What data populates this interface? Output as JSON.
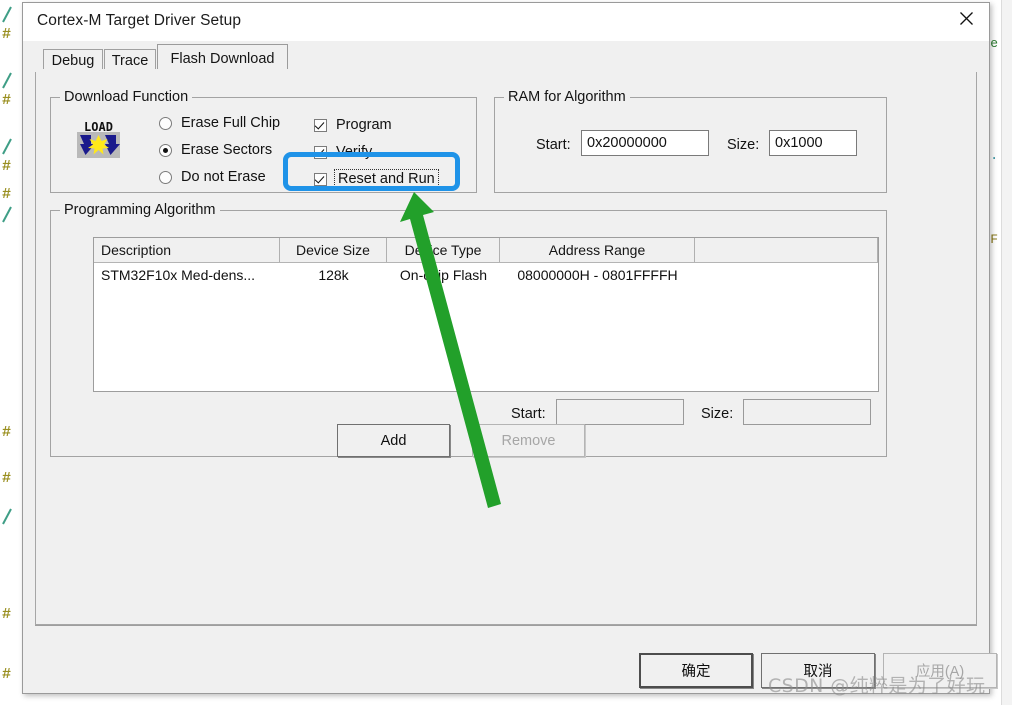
{
  "window": {
    "title": "Cortex-M Target Driver Setup",
    "close_icon": "close-icon"
  },
  "tabs": [
    {
      "label": "Debug",
      "active": false
    },
    {
      "label": "Trace",
      "active": false
    },
    {
      "label": "Flash Download",
      "active": true
    }
  ],
  "download_function": {
    "legend": "Download Function",
    "icon": "load-icon",
    "icon_text": "LOAD",
    "erase_mode": "Erase Sectors",
    "radios": [
      {
        "label": "Erase Full Chip",
        "selected": false
      },
      {
        "label": "Erase Sectors",
        "selected": true
      },
      {
        "label": "Do not Erase",
        "selected": false
      }
    ],
    "checkboxes": [
      {
        "label": "Program",
        "checked": true,
        "focused": false
      },
      {
        "label": "Verify",
        "checked": true,
        "focused": false
      },
      {
        "label": "Reset and Run",
        "checked": true,
        "focused": true
      }
    ]
  },
  "ram_for_algorithm": {
    "legend": "RAM for Algorithm",
    "start_label": "Start:",
    "start_value": "0x20000000",
    "size_label": "Size:",
    "size_value": "0x1000"
  },
  "programming_algorithm": {
    "legend": "Programming Algorithm",
    "columns": [
      "Description",
      "Device Size",
      "Device Type",
      "Address Range",
      ""
    ],
    "rows": [
      [
        "STM32F10x Med-dens...",
        "128k",
        "On-chip Flash",
        "08000000H - 0801FFFFH",
        ""
      ]
    ],
    "start_label": "Start:",
    "start_value": "",
    "size_label": "Size:",
    "size_value": "",
    "add_label": "Add",
    "remove_label": "Remove",
    "remove_enabled": false
  },
  "footer": {
    "ok_label": "确定",
    "cancel_label": "取消",
    "apply_label": "应用(A)",
    "apply_enabled": false
  },
  "annotations": {
    "highlight_color": "#1f93e8",
    "arrow_color": "#22a02a",
    "highlight_target": "Reset and Run",
    "watermark": "CSDN @纯粹是为了好玩"
  }
}
